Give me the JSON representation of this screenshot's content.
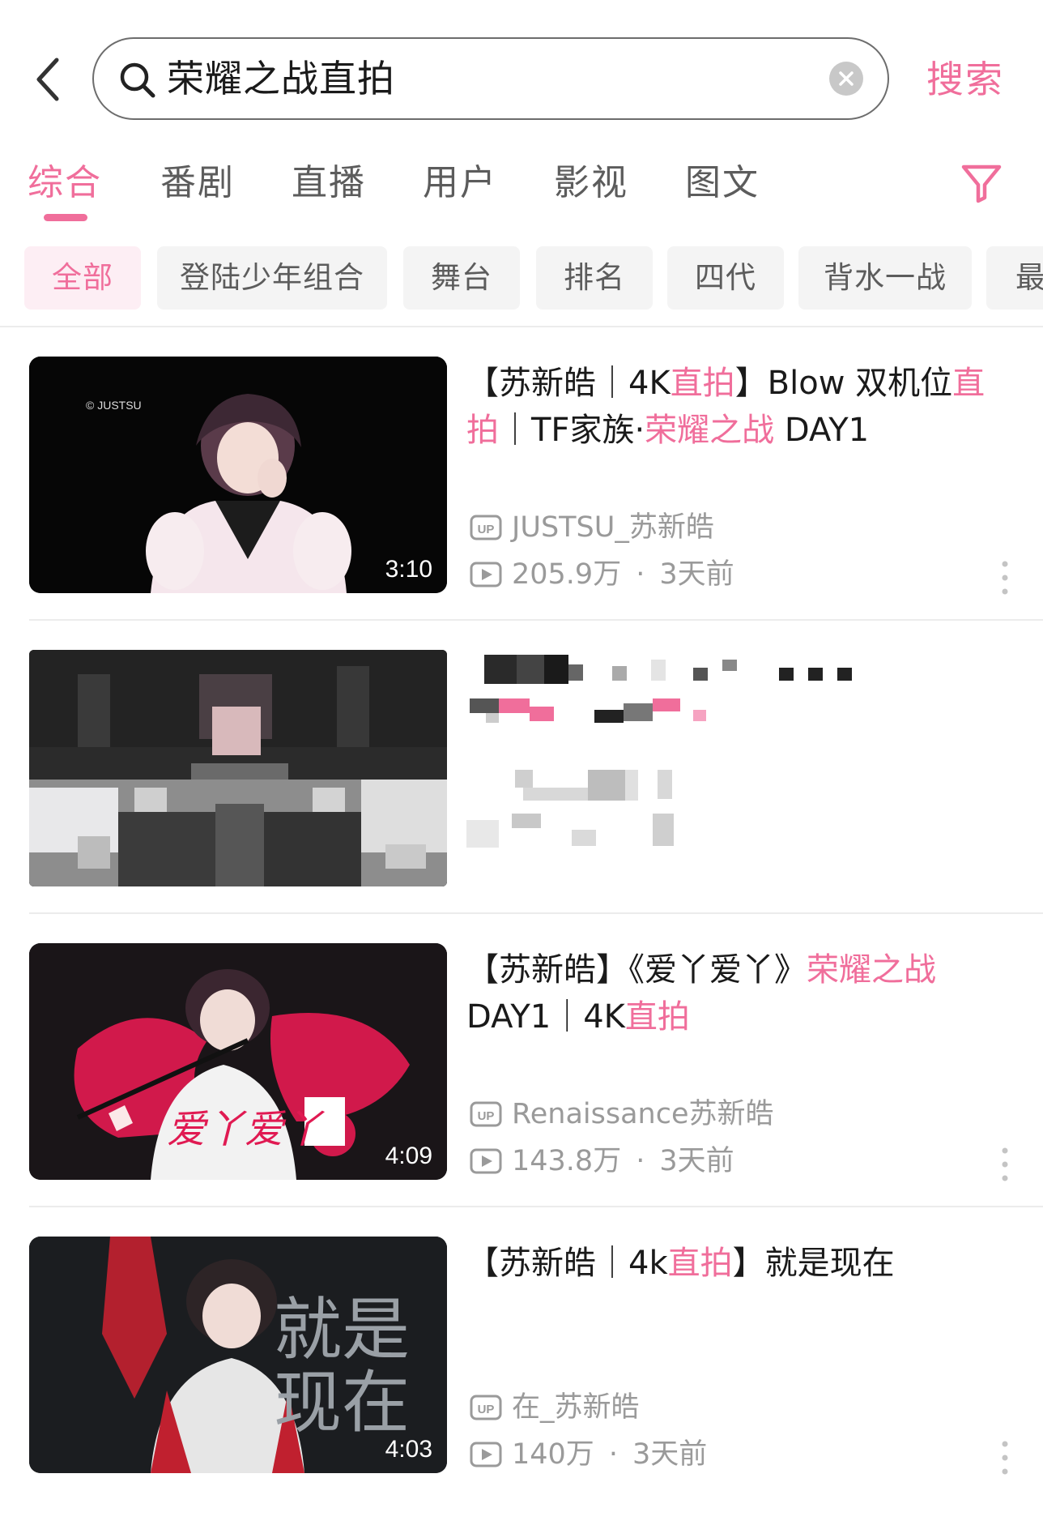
{
  "search": {
    "query": "荣耀之战直拍",
    "submit_label": "搜索"
  },
  "tabs": [
    {
      "label": "综合",
      "active": true
    },
    {
      "label": "番剧"
    },
    {
      "label": "直播"
    },
    {
      "label": "用户"
    },
    {
      "label": "影视"
    },
    {
      "label": "图文"
    }
  ],
  "chips": [
    {
      "label": "全部",
      "active": true
    },
    {
      "label": "登陆少年组合"
    },
    {
      "label": "舞台"
    },
    {
      "label": "排名"
    },
    {
      "label": "四代"
    },
    {
      "label": "背水一战"
    },
    {
      "label": "最"
    }
  ],
  "results": [
    {
      "title_parts": [
        {
          "t": "【苏新皓｜4K"
        },
        {
          "t": "直拍",
          "hl": true
        },
        {
          "t": "】Blow 双机位"
        },
        {
          "t": "直拍",
          "hl": true
        },
        {
          "t": "｜TF家族·"
        },
        {
          "t": "荣耀之战",
          "hl": true
        },
        {
          "t": " DAY1"
        }
      ],
      "uploader": "JUSTSU_苏新皓",
      "views": "205.9万",
      "time": "3天前",
      "duration": "3:10",
      "thumb_watermark": "© JUSTSU"
    },
    {
      "pixelated": true
    },
    {
      "title_parts": [
        {
          "t": "【苏新皓】《爱丫爱丫》"
        },
        {
          "t": "荣耀之战",
          "hl": true
        },
        {
          "t": " DAY1｜4K"
        },
        {
          "t": "直拍",
          "hl": true
        }
      ],
      "uploader": "Renaissance苏新皓",
      "views": "143.8万",
      "time": "3天前",
      "duration": "4:09",
      "thumb_text": "爱丫爱丫"
    },
    {
      "title_parts": [
        {
          "t": "【苏新皓｜4k"
        },
        {
          "t": "直拍",
          "hl": true
        },
        {
          "t": "】就是现在"
        }
      ],
      "uploader": "在_苏新皓",
      "views": "140万",
      "time": "3天前",
      "duration": "4:03",
      "thumb_text": [
        "就是",
        "现在"
      ]
    }
  ],
  "colors": {
    "accent": "#f06e9b",
    "text": "#1a1a1a",
    "muted": "#9a9a9a"
  },
  "icons": {
    "back": "chevron-left-icon",
    "search": "search-icon",
    "clear": "clear-icon",
    "filter": "filter-icon",
    "uploader": "up-badge-icon",
    "views": "play-count-icon",
    "more": "more-vertical-icon"
  }
}
